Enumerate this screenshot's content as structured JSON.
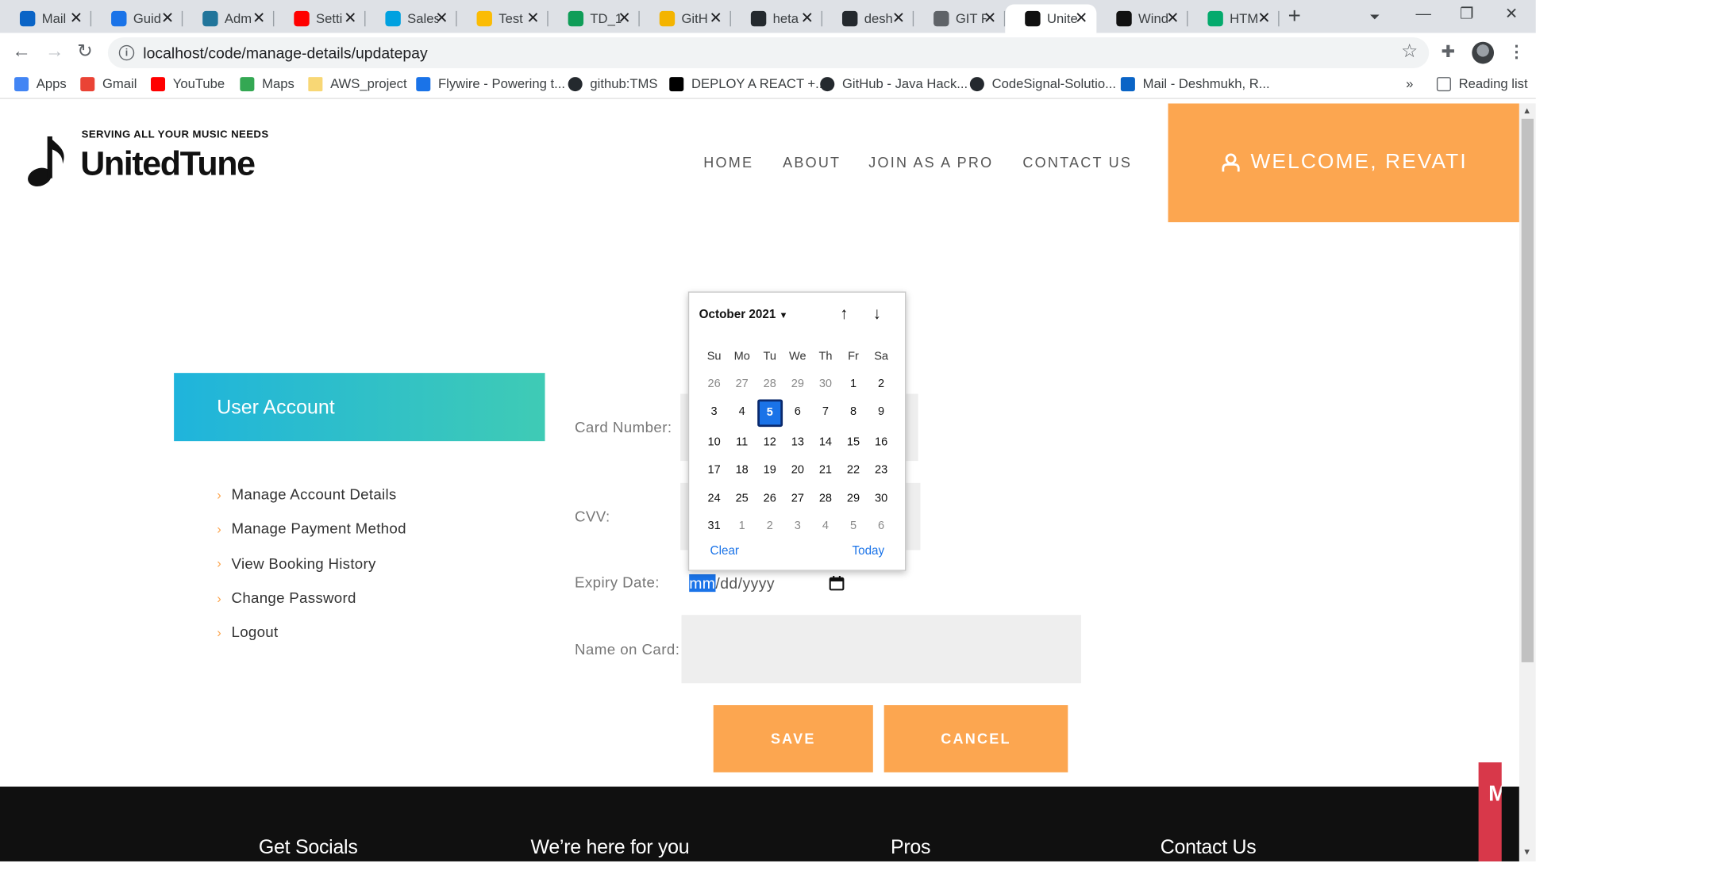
{
  "browser": {
    "tabs": [
      {
        "title": "Mail",
        "icon": "outlook-icon",
        "color": "#0a64c6"
      },
      {
        "title": "Guid",
        "icon": "guide-icon",
        "color": "#1a73e8"
      },
      {
        "title": "Adm",
        "icon": "wordpress-icon",
        "color": "#21759b"
      },
      {
        "title": "Setti",
        "icon": "youtube-icon",
        "color": "#ff0000"
      },
      {
        "title": "Sales",
        "icon": "salesforce-icon",
        "color": "#00a1e0"
      },
      {
        "title": "Test",
        "icon": "drive-icon",
        "color": "#fbbc04"
      },
      {
        "title": "TD_1",
        "icon": "sheets-icon",
        "color": "#0f9d58"
      },
      {
        "title": "GitH",
        "icon": "slides-icon",
        "color": "#f4b400"
      },
      {
        "title": "heta",
        "icon": "github-icon",
        "color": "#24292e"
      },
      {
        "title": "desh",
        "icon": "github-icon",
        "color": "#24292e"
      },
      {
        "title": "GIT F",
        "icon": "globe-icon",
        "color": "#5f6368"
      },
      {
        "title": "Unite",
        "icon": "music-note-icon",
        "color": "#111111",
        "active": true
      },
      {
        "title": "Wind",
        "icon": "notion-icon",
        "color": "#111111"
      },
      {
        "title": "HTM",
        "icon": "w3schools-icon",
        "color": "#04aa6d"
      }
    ],
    "url": "localhost/code/manage-details/updatepay",
    "bookmarks": [
      {
        "label": "Apps",
        "icon": "apps-grid-icon",
        "color": "#4285f4"
      },
      {
        "label": "Gmail",
        "icon": "gmail-icon",
        "color": "#ea4335"
      },
      {
        "label": "YouTube",
        "icon": "youtube-icon",
        "color": "#ff0000"
      },
      {
        "label": "Maps",
        "icon": "maps-pin-icon",
        "color": "#34a853"
      },
      {
        "label": "AWS_project",
        "icon": "folder-icon",
        "color": "#f8d775"
      },
      {
        "label": "Flywire - Powering t...",
        "icon": "flywire-icon",
        "color": "#1a73e8"
      },
      {
        "label": "github:TMS",
        "icon": "github-icon",
        "color": "#24292e"
      },
      {
        "label": "DEPLOY A REACT +...",
        "icon": "dev-icon",
        "color": "#000000"
      },
      {
        "label": "GitHub - Java Hack...",
        "icon": "github-icon",
        "color": "#24292e"
      },
      {
        "label": "CodeSignal-Solutio...",
        "icon": "github-icon",
        "color": "#24292e"
      },
      {
        "label": "Mail - Deshmukh, R...",
        "icon": "outlook-icon",
        "color": "#0a64c6"
      }
    ],
    "more_bookmarks": "»",
    "reading_list": "Reading list"
  },
  "site": {
    "tagline": "SERVING ALL YOUR MUSIC NEEDS",
    "brand": "UnitedTune",
    "nav": [
      "HOME",
      "ABOUT",
      "JOIN AS A PRO",
      "CONTACT US"
    ],
    "welcome": "WELCOME, REVATI",
    "accent": "#fca650"
  },
  "sidebar": {
    "title": "User Account",
    "items": [
      "Manage Account Details",
      "Manage Payment Method",
      "View Booking History",
      "Change Password",
      "Logout"
    ]
  },
  "form": {
    "card_number_label": "Card Number:",
    "cvv_label": "CVV:",
    "expiry_label": "Expiry Date:",
    "expiry_mm": "mm",
    "expiry_rest": "/dd/yyyy",
    "name_label": "Name on Card:",
    "save": "SAVE",
    "cancel": "CANCEL"
  },
  "datepicker": {
    "month": "October 2021",
    "weekdays": [
      "Su",
      "Mo",
      "Tu",
      "We",
      "Th",
      "Fr",
      "Sa"
    ],
    "days": [
      [
        "26",
        "27",
        "28",
        "29",
        "30",
        "1",
        "2"
      ],
      [
        "3",
        "4",
        "5",
        "6",
        "7",
        "8",
        "9"
      ],
      [
        "10",
        "11",
        "12",
        "13",
        "14",
        "15",
        "16"
      ],
      [
        "17",
        "18",
        "19",
        "20",
        "21",
        "22",
        "23"
      ],
      [
        "24",
        "25",
        "26",
        "27",
        "28",
        "29",
        "30"
      ],
      [
        "31",
        "1",
        "2",
        "3",
        "4",
        "5",
        "6"
      ]
    ],
    "selected_day": "5",
    "clear": "Clear",
    "today": "Today"
  },
  "footer": {
    "headings": [
      "Get Socials",
      "We’re here for you",
      "Pros",
      "Contact Us"
    ],
    "badge_text": "M"
  }
}
